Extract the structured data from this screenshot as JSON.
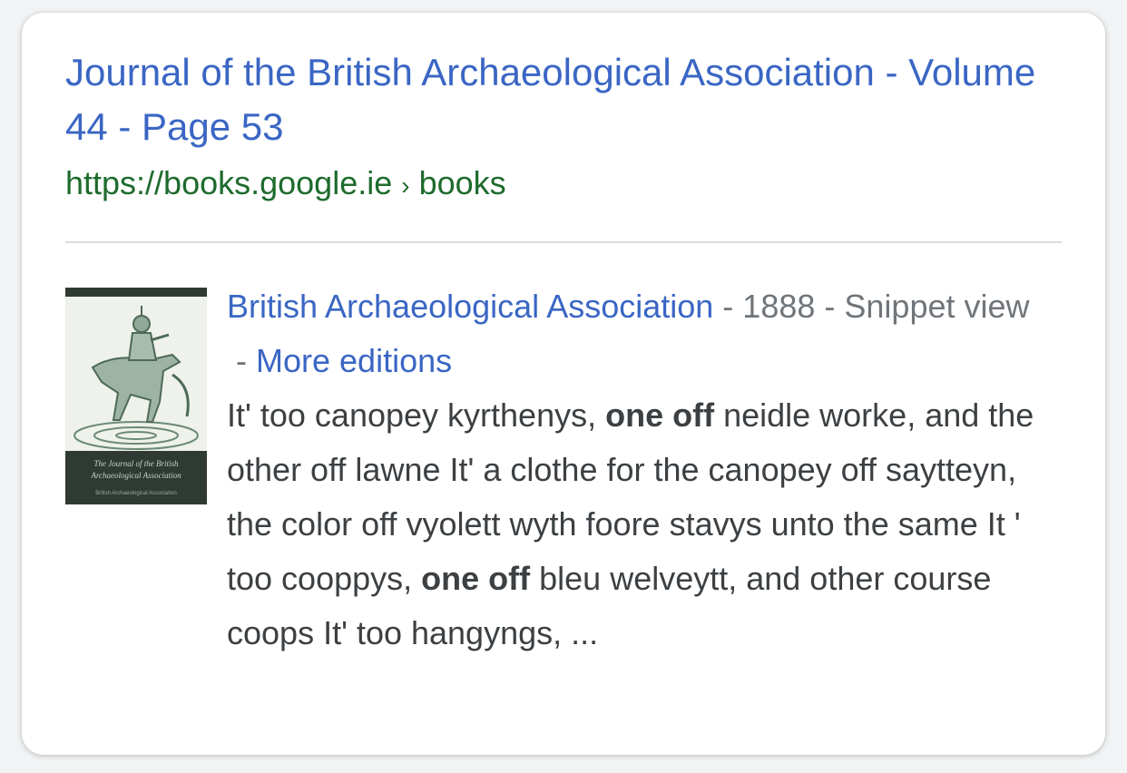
{
  "result": {
    "title": "Journal of the British Archaeological Association - Volume 44 - Page 53",
    "url_domain": "https://books.google.ie",
    "url_separator": "›",
    "url_path": "books"
  },
  "book": {
    "thumbnail_caption_line1": "The Journal of the British",
    "thumbnail_caption_line2": "Archaeological Association",
    "thumbnail_caption_line3": "British Archaeological Association",
    "author_link": "British Archaeological Association",
    "sep1": " - ",
    "year": "1888",
    "sep2": " - ",
    "view_type": "Snippet view",
    "sep3": " - ",
    "editions_link": "More editions",
    "snippet": {
      "part1": "It' too canopey kyrthenys, ",
      "bold1": "one off",
      "part2": " neidle worke, and the other off lawne It' a clothe for the canopey off saytteyn, the color off vyolett wyth foore stavys unto the same It ' too cooppys, ",
      "bold2": "one off",
      "part3": " bleu welveytt, and other course coops It' too hangyngs, ..."
    }
  },
  "colors": {
    "link": "#3a66c4",
    "url_green": "#1e6b2d",
    "text": "#3c4043",
    "meta_gray": "#70757a"
  }
}
